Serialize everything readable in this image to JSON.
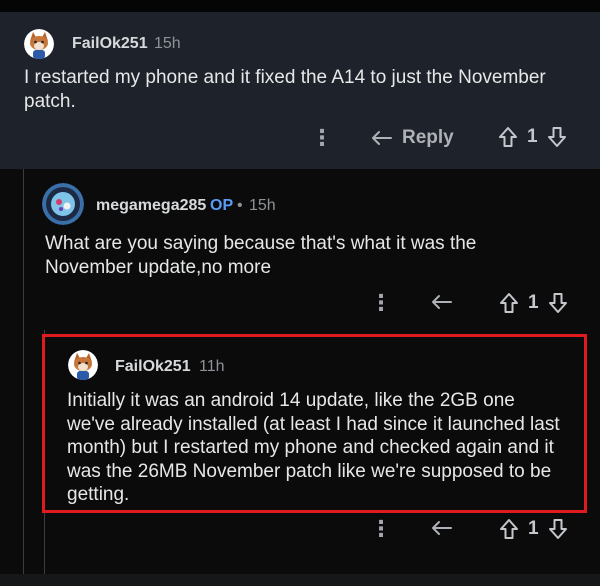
{
  "comments": [
    {
      "username": "FailOk251",
      "time": "15h",
      "op_badge": "",
      "text_lines": [
        "I restarted my phone and it fixed the A14 to just the November",
        "patch."
      ],
      "reply_label": "Reply",
      "vote_count": "1"
    },
    {
      "username": "megamega285",
      "op_badge": "OP",
      "separator": "•",
      "time": "15h",
      "text_lines": [
        "What are you saying because that's what it was the",
        "November update,no more"
      ],
      "vote_count": "1"
    },
    {
      "username": "FailOk251",
      "time": "11h",
      "op_badge": "",
      "text_lines": [
        "Initially it was an android 14 update, like the 2GB one",
        "we've already installed (at least I had since it launched last",
        "month) but I restarted my phone and checked again and it",
        "was the 26MB November patch like we're supposed to be",
        "getting."
      ],
      "vote_count": "1"
    }
  ],
  "colors": {
    "highlight_border": "#e01b1f",
    "op_badge": "#5a9cf5",
    "top_comment_bg": "#1e222a",
    "page_bg": "#0b0b0c"
  },
  "icons": [
    "kebab-menu-icon",
    "reply-arrow-icon",
    "upvote-arrow-icon",
    "downvote-arrow-icon",
    "avatar-fox-icon",
    "avatar-character-icon"
  ]
}
